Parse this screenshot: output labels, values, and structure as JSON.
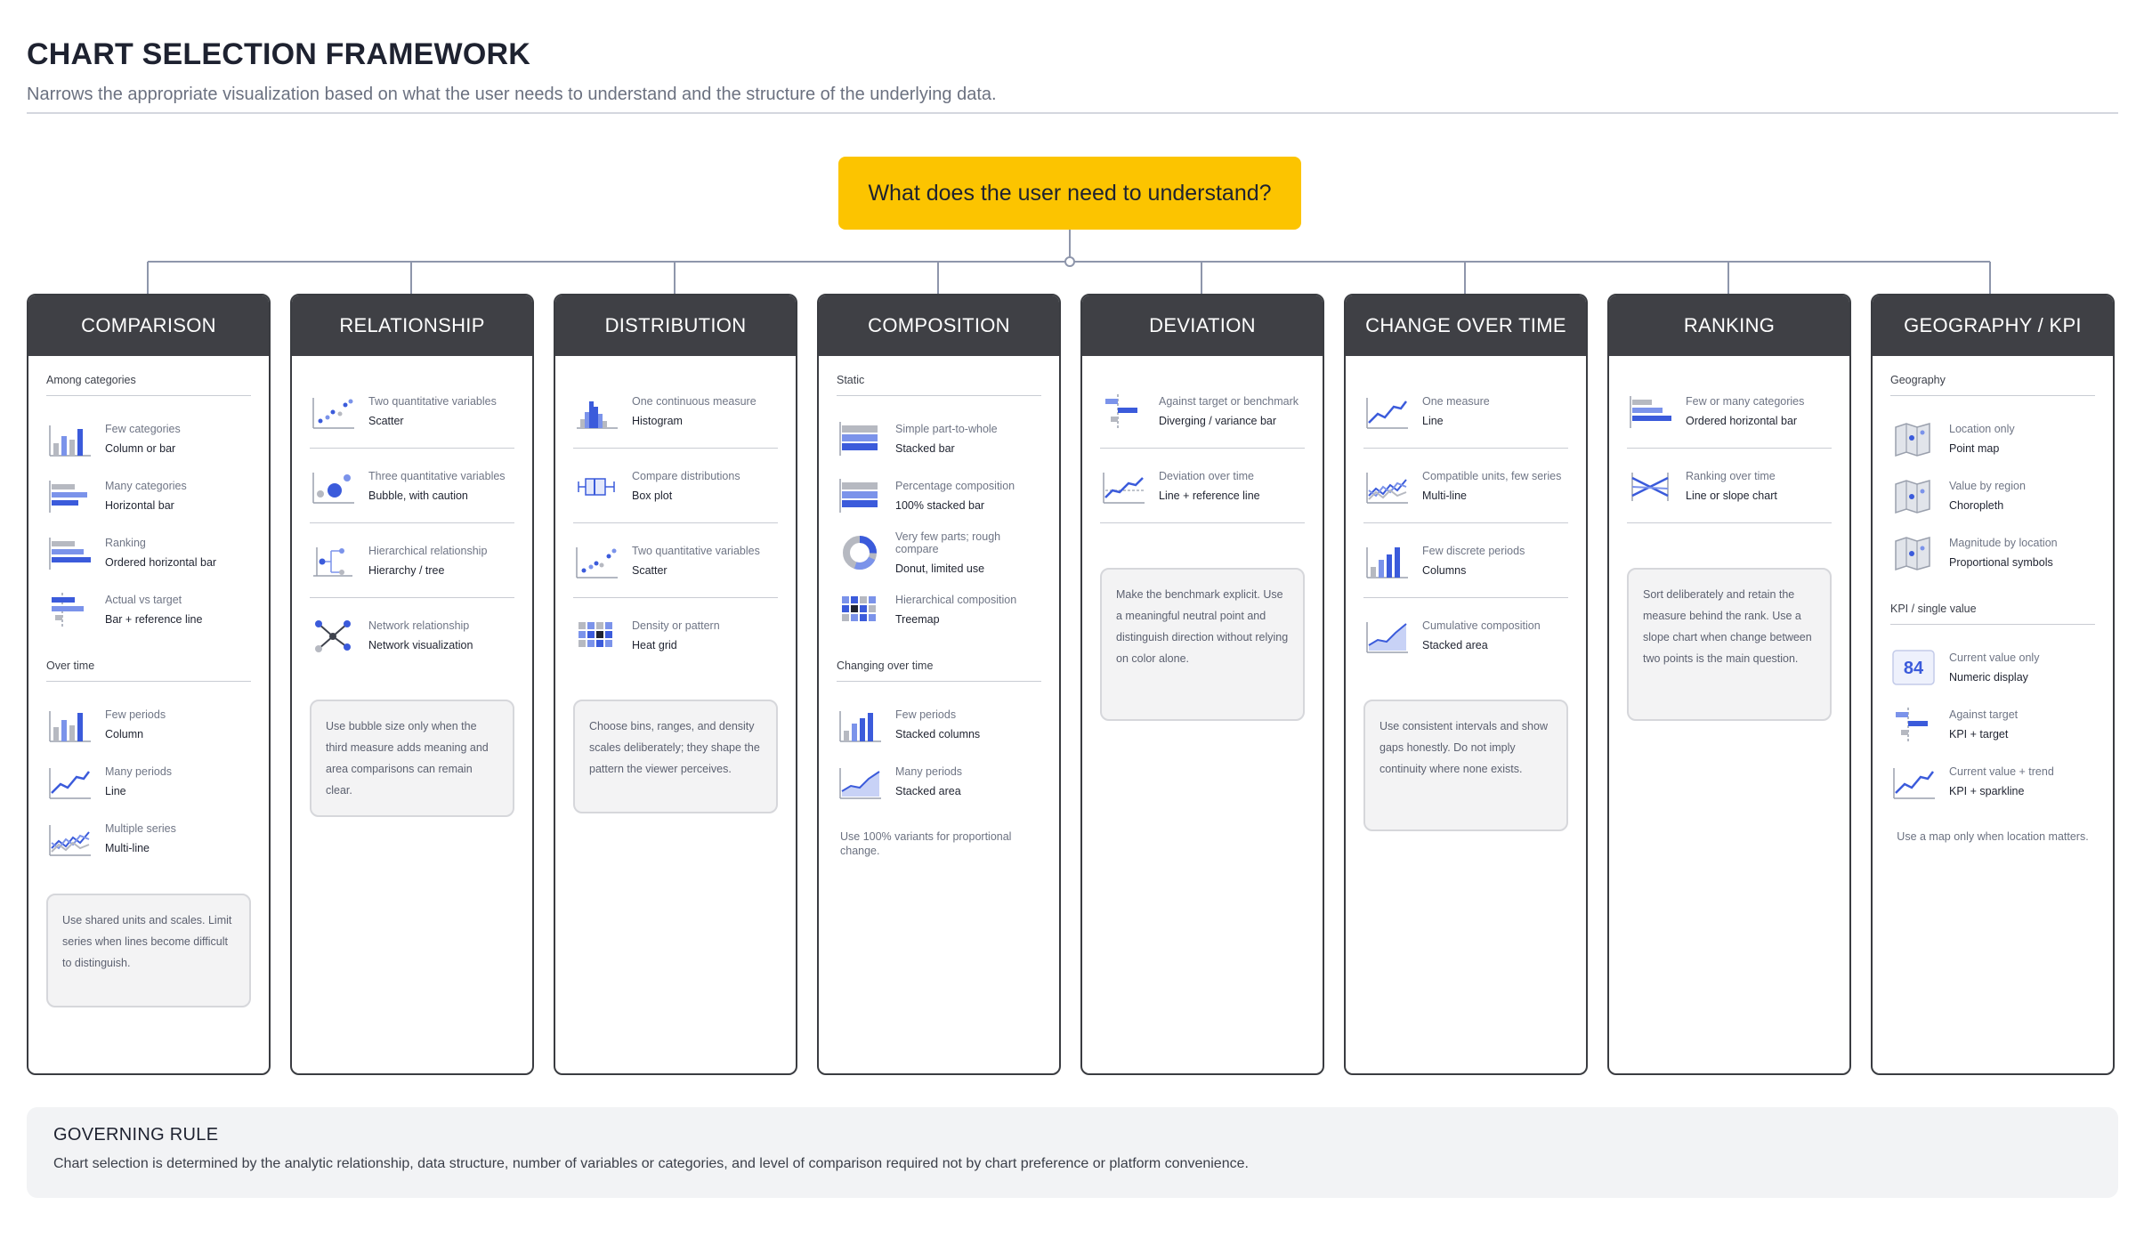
{
  "header": {
    "title": "CHART SELECTION FRAMEWORK",
    "subtitle": "Narrows the appropriate visualization based on what the user needs to understand and the structure of the underlying data."
  },
  "question": "What does the user need to understand?",
  "colors": {
    "accent": "#3b5bdb",
    "accent_light": "#7b93ea",
    "neutral": "#b6b9c1",
    "question": "#fcc400",
    "header_bg": "#3f4045"
  },
  "columns": [
    {
      "title": "COMPARISON",
      "section1": "Among categories",
      "items1": [
        {
          "icon": "column-chart-icon",
          "label": "Few categories",
          "value": "Column or bar"
        },
        {
          "icon": "horizontal-bar-icon",
          "label": "Many categories",
          "value": "Horizontal bar"
        },
        {
          "icon": "ordered-bar-icon",
          "label": "Ranking",
          "value": "Ordered horizontal bar"
        },
        {
          "icon": "bar-reference-icon",
          "label": "Actual vs target",
          "value": "Bar + reference line"
        }
      ],
      "section2": "Over time",
      "items2": [
        {
          "icon": "column-chart-icon",
          "label": "Few periods",
          "value": "Column"
        },
        {
          "icon": "line-chart-icon",
          "label": "Many periods",
          "value": "Line"
        },
        {
          "icon": "multi-line-icon",
          "label": "Multiple series",
          "value": "Multi-line"
        }
      ],
      "note": "Use shared units and scales. Limit series when lines become difficult to distinguish."
    },
    {
      "title": "RELATIONSHIP",
      "items": [
        {
          "icon": "scatter-icon",
          "label": "Two quantitative variables",
          "value": "Scatter"
        },
        {
          "icon": "bubble-icon",
          "label": "Three quantitative variables",
          "value": "Bubble, with caution"
        },
        {
          "icon": "hierarchy-icon",
          "label": "Hierarchical relationship",
          "value": "Hierarchy / tree"
        },
        {
          "icon": "network-icon",
          "label": "Network relationship",
          "value": "Network visualization"
        }
      ],
      "note": "Use bubble size only when the third measure adds meaning and area comparisons can remain clear."
    },
    {
      "title": "DISTRIBUTION",
      "items": [
        {
          "icon": "histogram-icon",
          "label": "One continuous measure",
          "value": "Histogram"
        },
        {
          "icon": "box-plot-icon",
          "label": "Compare distributions",
          "value": "Box plot"
        },
        {
          "icon": "scatter-icon",
          "label": "Two quantitative variables",
          "value": "Scatter"
        },
        {
          "icon": "heat-grid-icon",
          "label": "Density or pattern",
          "value": "Heat grid"
        }
      ],
      "note": "Choose bins, ranges, and density scales deliberately; they shape the pattern the viewer perceives."
    },
    {
      "title": "COMPOSITION",
      "section1": "Static",
      "items1": [
        {
          "icon": "stacked-bar-icon",
          "label": "Simple part-to-whole",
          "value": "Stacked bar"
        },
        {
          "icon": "percent-stacked-bar-icon",
          "label": "Percentage composition",
          "value": "100% stacked bar"
        },
        {
          "icon": "donut-icon",
          "label": "Very few parts; rough compare",
          "value": "Donut, limited use"
        },
        {
          "icon": "treemap-icon",
          "label": "Hierarchical composition",
          "value": "Treemap"
        }
      ],
      "section2": "Changing over time",
      "items2": [
        {
          "icon": "stacked-columns-icon",
          "label": "Few periods",
          "value": "Stacked columns"
        },
        {
          "icon": "stacked-area-icon",
          "label": "Many periods",
          "value": "Stacked area"
        }
      ],
      "note": "Use 100% variants for proportional change."
    },
    {
      "title": "DEVIATION",
      "items": [
        {
          "icon": "diverging-bar-icon",
          "label": "Against target or benchmark",
          "value": "Diverging / variance bar"
        },
        {
          "icon": "line-reference-icon",
          "label": "Deviation over time",
          "value": "Line + reference line"
        }
      ],
      "note": "Make the benchmark explicit. Use a meaningful neutral point and distinguish direction without relying on color alone."
    },
    {
      "title": "CHANGE OVER TIME",
      "items": [
        {
          "icon": "line-chart-icon",
          "label": "One measure",
          "value": "Line"
        },
        {
          "icon": "multi-line-icon",
          "label": "Compatible units, few series",
          "value": "Multi-line"
        },
        {
          "icon": "column-chart-icon",
          "label": "Few discrete periods",
          "value": "Columns"
        },
        {
          "icon": "stacked-area-icon",
          "label": "Cumulative composition",
          "value": "Stacked area"
        }
      ],
      "note": "Use consistent intervals and show gaps honestly. Do not imply continuity where none exists."
    },
    {
      "title": "RANKING",
      "items": [
        {
          "icon": "ordered-bar-icon",
          "label": "Few or many categories",
          "value": "Ordered horizontal bar"
        },
        {
          "icon": "slope-chart-icon",
          "label": "Ranking over time",
          "value": "Line or slope chart"
        }
      ],
      "note": "Sort deliberately and retain the measure behind the rank. Use a slope chart when change between two points is the main question."
    },
    {
      "title": "GEOGRAPHY / KPI",
      "section1": "Geography",
      "items1": [
        {
          "icon": "map-icon",
          "label": "Location only",
          "value": "Point map"
        },
        {
          "icon": "map-icon",
          "label": "Value by region",
          "value": "Choropleth"
        },
        {
          "icon": "map-icon",
          "label": "Magnitude by location",
          "value": "Proportional symbols"
        }
      ],
      "section2": "KPI / single value",
      "items2": [
        {
          "icon": "kpi-number-icon",
          "label": "Current value only",
          "value": "Numeric display",
          "kpi": "84"
        },
        {
          "icon": "kpi-target-icon",
          "label": "Against target",
          "value": "KPI + target"
        },
        {
          "icon": "sparkline-icon",
          "label": "Current value + trend",
          "value": "KPI + sparkline"
        }
      ],
      "note": "Use a map only when location matters."
    }
  ],
  "rule": {
    "title": "GOVERNING RULE",
    "body": "Chart selection is determined by the analytic relationship, data structure, number of variables or categories, and level of comparison required not by chart preference or platform convenience."
  }
}
